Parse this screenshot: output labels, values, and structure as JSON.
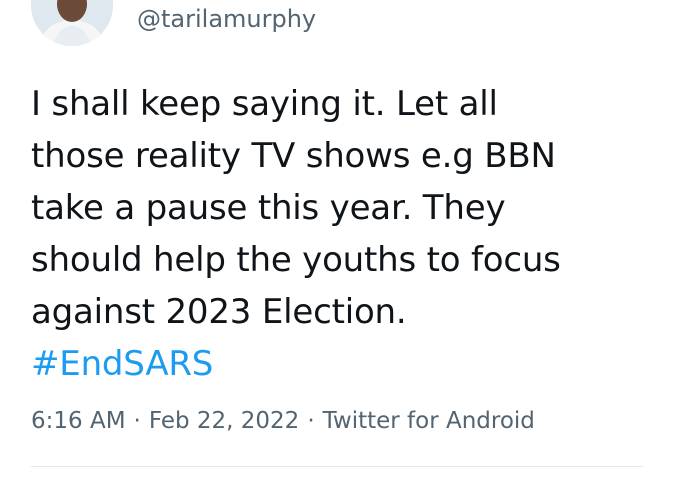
{
  "tweet": {
    "handle": "@tarilamurphy",
    "text_lines": [
      "I shall keep saying it. Let all",
      "those reality TV shows e.g BBN",
      "take a pause this year. They",
      "should help the youths to focus",
      "against 2023 Election."
    ],
    "hashtag": "#EndSARS",
    "time": "6:16 AM",
    "separator": "·",
    "date": "Feb 22, 2022",
    "source": "Twitter for Android"
  },
  "colors": {
    "text": "#0f1419",
    "secondary": "#536471",
    "link": "#1d9bf0",
    "divider": "#e4e9ec"
  },
  "icons": {
    "avatar": "user-avatar-photo"
  }
}
